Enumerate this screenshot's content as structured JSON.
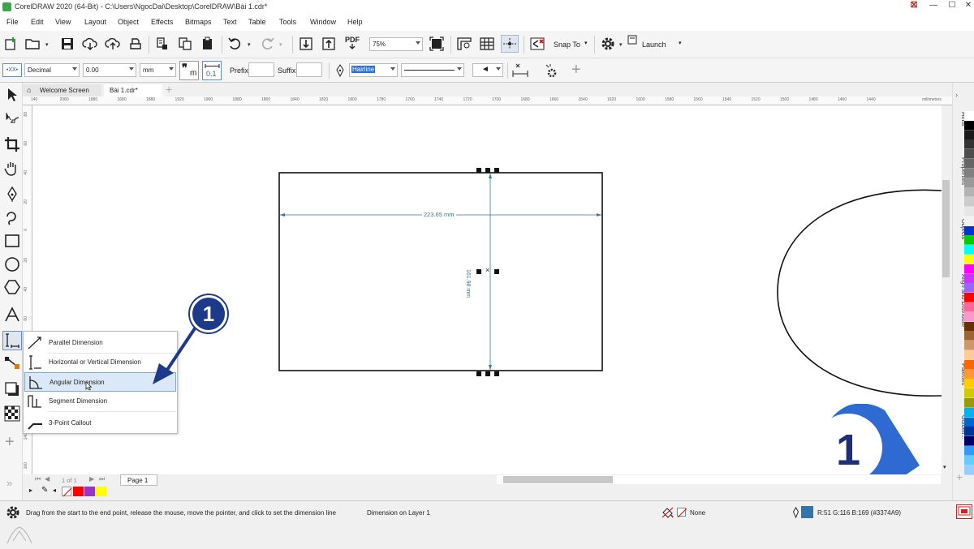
{
  "window": {
    "title": "CorelDRAW 2020 (64-Bit) - C:\\Users\\NgocDai\\Desktop\\CorelDRAW\\Bài 1.cdr*",
    "min": "—",
    "max": "☐",
    "close": "✕"
  },
  "menu": [
    "File",
    "Edit",
    "View",
    "Layout",
    "Object",
    "Effects",
    "Bitmaps",
    "Text",
    "Table",
    "Tools",
    "Window",
    "Help"
  ],
  "toolbar1": {
    "zoom": "75%",
    "snap_to": "Snap To",
    "launch": "Launch",
    "pdf_label": "PDF"
  },
  "toolbar2": {
    "style": "Decimal",
    "precision": "0.00",
    "units": "mm",
    "prefix_label": "Prefix:",
    "suffix_label": "Suffix:",
    "outline_width": "Hairline",
    "dim_text_m": "m",
    "dim_text_num": "0.1",
    "xx_label": "•XX•"
  },
  "tabs": {
    "welcome": "Welcome Screen",
    "doc": "Bài 1.cdr*",
    "add": "+"
  },
  "ruler": {
    "h_ticks": [
      "140",
      "2080",
      "1880",
      "1680",
      "1880",
      "1920",
      "1900",
      "1880",
      "1860",
      "1840",
      "1820",
      "1800",
      "1780",
      "1760",
      "1740",
      "1720",
      "1700",
      "1680",
      "1660",
      "1640",
      "1620",
      "1600",
      "1580",
      "1560",
      "1540",
      "1520",
      "1500",
      "1480",
      "1460",
      "1440"
    ],
    "unit": "millimeters",
    "v_ticks": [
      "80",
      "60",
      "40",
      "20",
      "0",
      "20",
      "40",
      "60",
      "80",
      "100",
      "120",
      "140",
      "160"
    ]
  },
  "canvas": {
    "dimension_h": "223.65 mm",
    "dimension_v": "161.98 mm"
  },
  "flyout": {
    "items": [
      "Parallel Dimension",
      "Horizontal or Vertical Dimension",
      "Angular Dimension",
      "Segment Dimension",
      "3-Point Callout"
    ]
  },
  "callout": {
    "small_number": "1",
    "big_number": "1"
  },
  "dock": {
    "tabs": [
      "Hints",
      "Properties",
      "Objects",
      "Align and Distribute",
      "Palettes",
      "Guideli..."
    ]
  },
  "palette": {
    "colors": [
      "#ffffff",
      "#000000",
      "#1a1a1a",
      "#333333",
      "#4d4d4d",
      "#666666",
      "#808080",
      "#999999",
      "#b3b3b3",
      "#cccccc",
      "#e6e6e6",
      "#f2f2f2",
      "#0033cc",
      "#00cc00",
      "#00ffff",
      "#ffff00",
      "#ff00ff",
      "#cc33ff",
      "#9966ff",
      "#ff0000",
      "#ff6699",
      "#ff99cc",
      "#663300",
      "#996633",
      "#cc9966",
      "#ffcc99",
      "#ff6600",
      "#ff9933",
      "#ffcc00",
      "#cccc00",
      "#999900",
      "#00b2ee",
      "#0066cc",
      "#003399",
      "#000066",
      "#3399ff",
      "#66ccff",
      "#99ccff"
    ],
    "doc_colors": [
      "#ff0000",
      "#9933cc",
      "#ffff00"
    ]
  },
  "pagebar": {
    "page_of": "1 of 1",
    "page_label": "Page 1"
  },
  "status": {
    "hint": "Drag from the start to the end point, release the mouse, move the pointer, and click to set the dimension line",
    "layer": "Dimension on Layer 1",
    "fill": "None",
    "outline_color": "R:51 G:116 B:169 (#3374A9)",
    "outline_swatch": "#3374A9"
  }
}
